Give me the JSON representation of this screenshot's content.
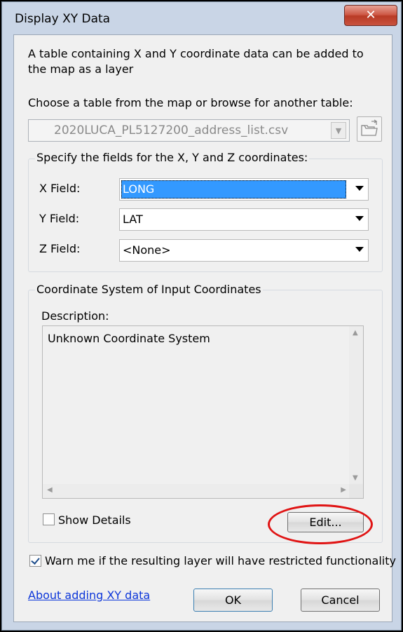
{
  "window": {
    "title": "Display XY Data",
    "close_glyph": "✕"
  },
  "intro_text": "A table containing X and Y coordinate data can be added to the map as a layer",
  "choose_table": {
    "label": "Choose a table from the map or browse for another table:",
    "selected": "2020LUCA_PL5127200_address_list.csv",
    "browse_icon": "folder-open-icon"
  },
  "fields_group": {
    "label": "Specify the fields for the X, Y and Z coordinates:",
    "x_label": "X Field:",
    "x_value": "LONG",
    "y_label": "Y Field:",
    "y_value": "LAT",
    "z_label": "Z Field:",
    "z_value": "<None>"
  },
  "coord_group": {
    "label": "Coordinate System of Input Coordinates",
    "description_label": "Description:",
    "description_text": "Unknown Coordinate System",
    "show_details_label": "Show Details",
    "show_details_checked": false,
    "edit_label": "Edit..."
  },
  "warn": {
    "label": "Warn me if the resulting layer will have restricted functionality",
    "checked": true
  },
  "footer": {
    "about_link": "About adding XY data",
    "ok_label": "OK",
    "cancel_label": "Cancel"
  },
  "annotation": {
    "color": "#e01414"
  }
}
